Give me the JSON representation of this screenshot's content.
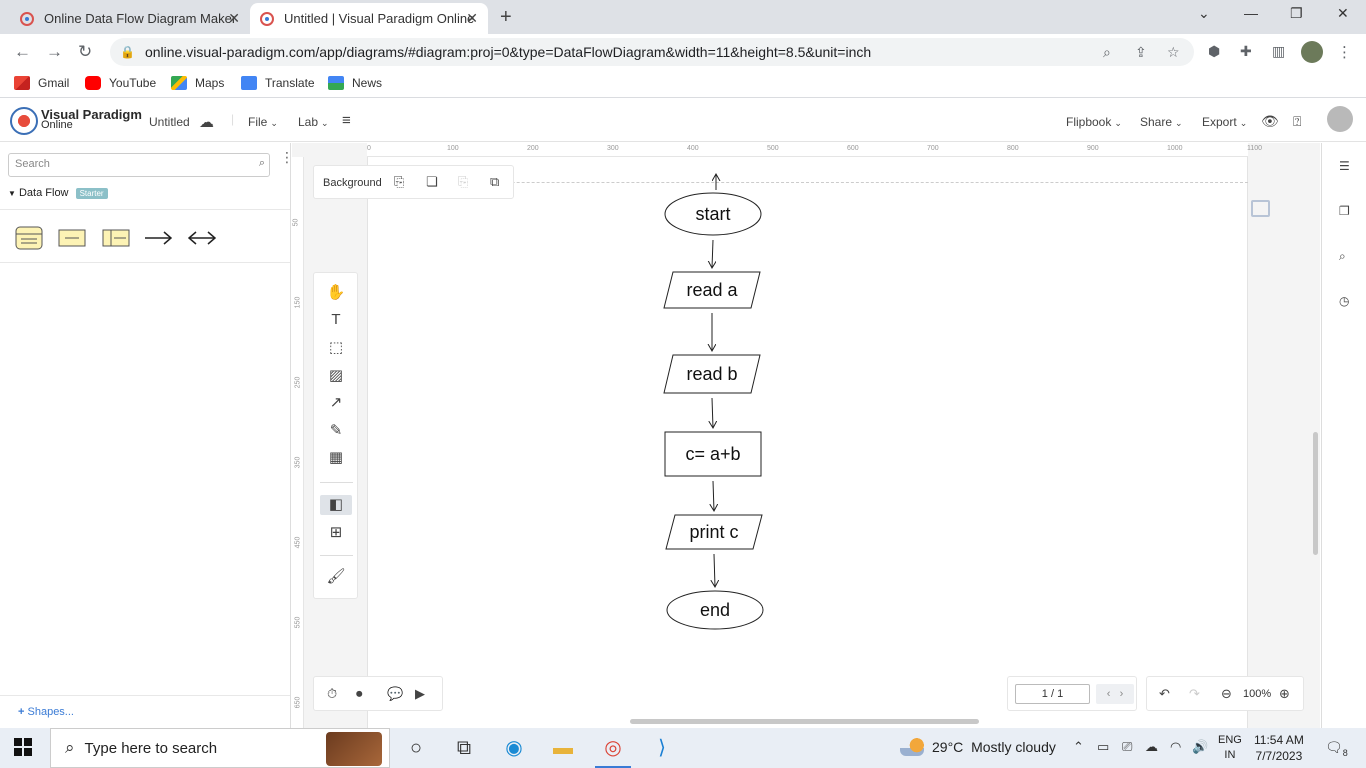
{
  "browser": {
    "tabs": [
      {
        "title": "Online Data Flow Diagram Maker",
        "active": false
      },
      {
        "title": "Untitled | Visual Paradigm Online",
        "active": true
      }
    ],
    "url": "online.visual-paradigm.com/app/diagrams/#diagram:proj=0&type=DataFlowDiagram&width=11&height=8.5&unit=inch",
    "bookmarks": [
      "Gmail",
      "YouTube",
      "Maps",
      "Translate",
      "News"
    ]
  },
  "app": {
    "logo_line1": "Visual Paradigm",
    "logo_line2": "Online",
    "doc_title": "Untitled",
    "menus": [
      "File",
      "Lab"
    ],
    "right_menus": [
      "Flipbook",
      "Share",
      "Export"
    ]
  },
  "left_panel": {
    "search_placeholder": "Search",
    "section_title": "Data Flow",
    "section_badge": "Starter",
    "shapes_link": "Shapes..."
  },
  "canvas": {
    "background_label": "Background",
    "ruler_top": [
      "0",
      "100",
      "200",
      "300",
      "400",
      "500",
      "600",
      "700",
      "800",
      "900",
      "1000",
      "1100"
    ],
    "ruler_left": [
      "50",
      "150",
      "250",
      "350",
      "450",
      "550",
      "650"
    ],
    "page_indicator": "1 / 1",
    "zoom": "100%"
  },
  "flowchart": {
    "nodes": [
      {
        "id": "start",
        "label": "start",
        "shape": "ellipse"
      },
      {
        "id": "read_a",
        "label": "read a",
        "shape": "parallelogram"
      },
      {
        "id": "read_b",
        "label": "read b",
        "shape": "parallelogram"
      },
      {
        "id": "calc",
        "label": "c= a+b",
        "shape": "rectangle"
      },
      {
        "id": "print_c",
        "label": "print c",
        "shape": "parallelogram"
      },
      {
        "id": "end",
        "label": "end",
        "shape": "ellipse"
      }
    ],
    "edges": [
      [
        "start",
        "read_a"
      ],
      [
        "read_a",
        "read_b"
      ],
      [
        "read_b",
        "calc"
      ],
      [
        "calc",
        "print_c"
      ],
      [
        "print_c",
        "end"
      ]
    ]
  },
  "taskbar": {
    "search_placeholder": "Type here to search",
    "weather_temp": "29°C",
    "weather_text": "Mostly cloudy",
    "lang_line1": "ENG",
    "lang_line2": "IN",
    "time": "11:54 AM",
    "date": "7/7/2023",
    "notification_count": "8"
  }
}
